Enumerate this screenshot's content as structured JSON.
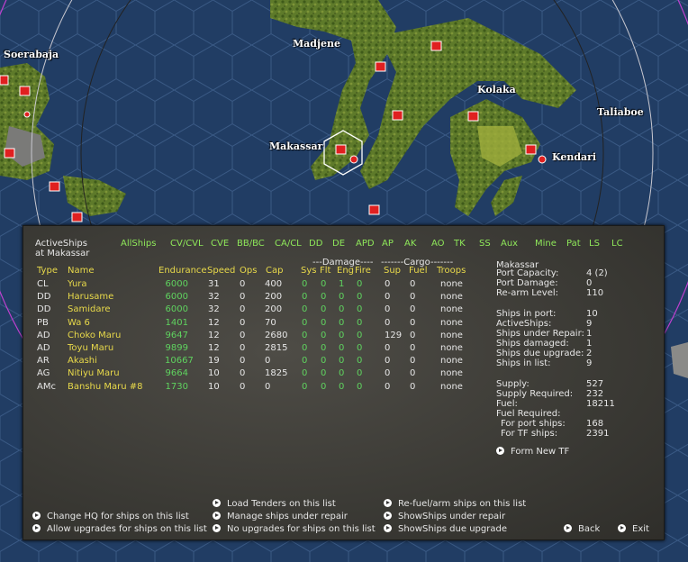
{
  "map_labels": {
    "soerabaja": "Soerabaja",
    "madjene": "Madjene",
    "kolaka": "Kolaka",
    "taliaboe": "Taliaboe",
    "makassar": "Makassar",
    "kendari": "Kendari"
  },
  "panel": {
    "title_line1": "ActiveShips",
    "title_line2": "at Makassar",
    "filters": [
      "AllShips",
      "CV/CVL",
      "CVE",
      "BB/BC",
      "CA/CL",
      "DD",
      "DE",
      "APD",
      "AP",
      "AK",
      "AO",
      "TK",
      "SS",
      "Aux",
      "Mine",
      "Pat",
      "LS",
      "LC"
    ],
    "group_headers": {
      "damage": "---Damage----",
      "cargo": "-------Cargo-------"
    },
    "columns": [
      "Type",
      "Name",
      "Endurance",
      "Speed",
      "Ops",
      "Cap",
      "Sys",
      "Flt",
      "Eng",
      "Fire",
      "Sup",
      "Fuel",
      "Troops"
    ],
    "ships": [
      {
        "type": "CL",
        "name": "Yura",
        "endurance": "6000",
        "speed": "31",
        "ops": "0",
        "cap": "400",
        "sys": "0",
        "flt": "0",
        "eng": "1",
        "fire": "0",
        "sup": "0",
        "fuel": "0",
        "troops": "none"
      },
      {
        "type": "DD",
        "name": "Harusame",
        "endurance": "6000",
        "speed": "32",
        "ops": "0",
        "cap": "200",
        "sys": "0",
        "flt": "0",
        "eng": "0",
        "fire": "0",
        "sup": "0",
        "fuel": "0",
        "troops": "none"
      },
      {
        "type": "DD",
        "name": "Samidare",
        "endurance": "6000",
        "speed": "32",
        "ops": "0",
        "cap": "200",
        "sys": "0",
        "flt": "0",
        "eng": "0",
        "fire": "0",
        "sup": "0",
        "fuel": "0",
        "troops": "none"
      },
      {
        "type": "PB",
        "name": "Wa 6",
        "endurance": "1401",
        "speed": "12",
        "ops": "0",
        "cap": "70",
        "sys": "0",
        "flt": "0",
        "eng": "0",
        "fire": "0",
        "sup": "0",
        "fuel": "0",
        "troops": "none"
      },
      {
        "type": "AD",
        "name": "Choko Maru",
        "endurance": "9647",
        "speed": "12",
        "ops": "0",
        "cap": "2680",
        "sys": "0",
        "flt": "0",
        "eng": "0",
        "fire": "0",
        "sup": "129",
        "fuel": "0",
        "troops": "none"
      },
      {
        "type": "AD",
        "name": "Toyu Maru",
        "endurance": "9899",
        "speed": "12",
        "ops": "0",
        "cap": "2815",
        "sys": "0",
        "flt": "0",
        "eng": "0",
        "fire": "0",
        "sup": "0",
        "fuel": "0",
        "troops": "none"
      },
      {
        "type": "AR",
        "name": "Akashi",
        "endurance": "10667",
        "speed": "19",
        "ops": "0",
        "cap": "0",
        "sys": "0",
        "flt": "0",
        "eng": "0",
        "fire": "0",
        "sup": "0",
        "fuel": "0",
        "troops": "none"
      },
      {
        "type": "AG",
        "name": "Nitiyu Maru",
        "endurance": "9664",
        "speed": "10",
        "ops": "0",
        "cap": "1825",
        "sys": "0",
        "flt": "0",
        "eng": "0",
        "fire": "0",
        "sup": "0",
        "fuel": "0",
        "troops": "none"
      },
      {
        "type": "AMc",
        "name": "Banshu Maru #8",
        "endurance": "1730",
        "speed": "10",
        "ops": "0",
        "cap": "0",
        "sys": "0",
        "flt": "0",
        "eng": "0",
        "fire": "0",
        "sup": "0",
        "fuel": "0",
        "troops": "none"
      }
    ],
    "base": {
      "name": "Makassar",
      "stats": [
        {
          "label": "Port Capacity:",
          "value": "4 (2)"
        },
        {
          "label": "Port Damage:",
          "value": "0"
        },
        {
          "label": "Re-arm Level:",
          "value": "110"
        },
        {
          "label": "Ships in port:",
          "value": "10"
        },
        {
          "label": "ActiveShips:",
          "value": "9"
        },
        {
          "label": "Ships under Repair:",
          "value": "1"
        },
        {
          "label": "Ships damaged:",
          "value": "1"
        },
        {
          "label": "Ships due upgrade:",
          "value": "2"
        },
        {
          "label": "Ships in list:",
          "value": "9"
        },
        {
          "label": "Supply:",
          "value": "527"
        },
        {
          "label": "Supply Required:",
          "value": "232"
        },
        {
          "label": "Fuel:",
          "value": "18211"
        },
        {
          "label": "Fuel Required:",
          "value": ""
        },
        {
          "label": "For port ships:",
          "value": "168"
        },
        {
          "label": "For TF ships:",
          "value": "2391"
        }
      ],
      "form_new_tf": "Form New TF"
    },
    "actions": {
      "load_tenders": "Load Tenders on this list",
      "refuel_rearm": "Re-fuel/arm ships on this list",
      "change_hq": "Change HQ for ships on this list",
      "manage_repair": "Manage ships under repair",
      "show_under_repair": "ShowShips under repair",
      "allow_upgrades": "Allow upgrades for ships on this list",
      "no_upgrades": "No upgrades for ships on this list",
      "show_due_upgrade": "ShowShips due upgrade",
      "back": "Back",
      "exit": "Exit"
    }
  }
}
